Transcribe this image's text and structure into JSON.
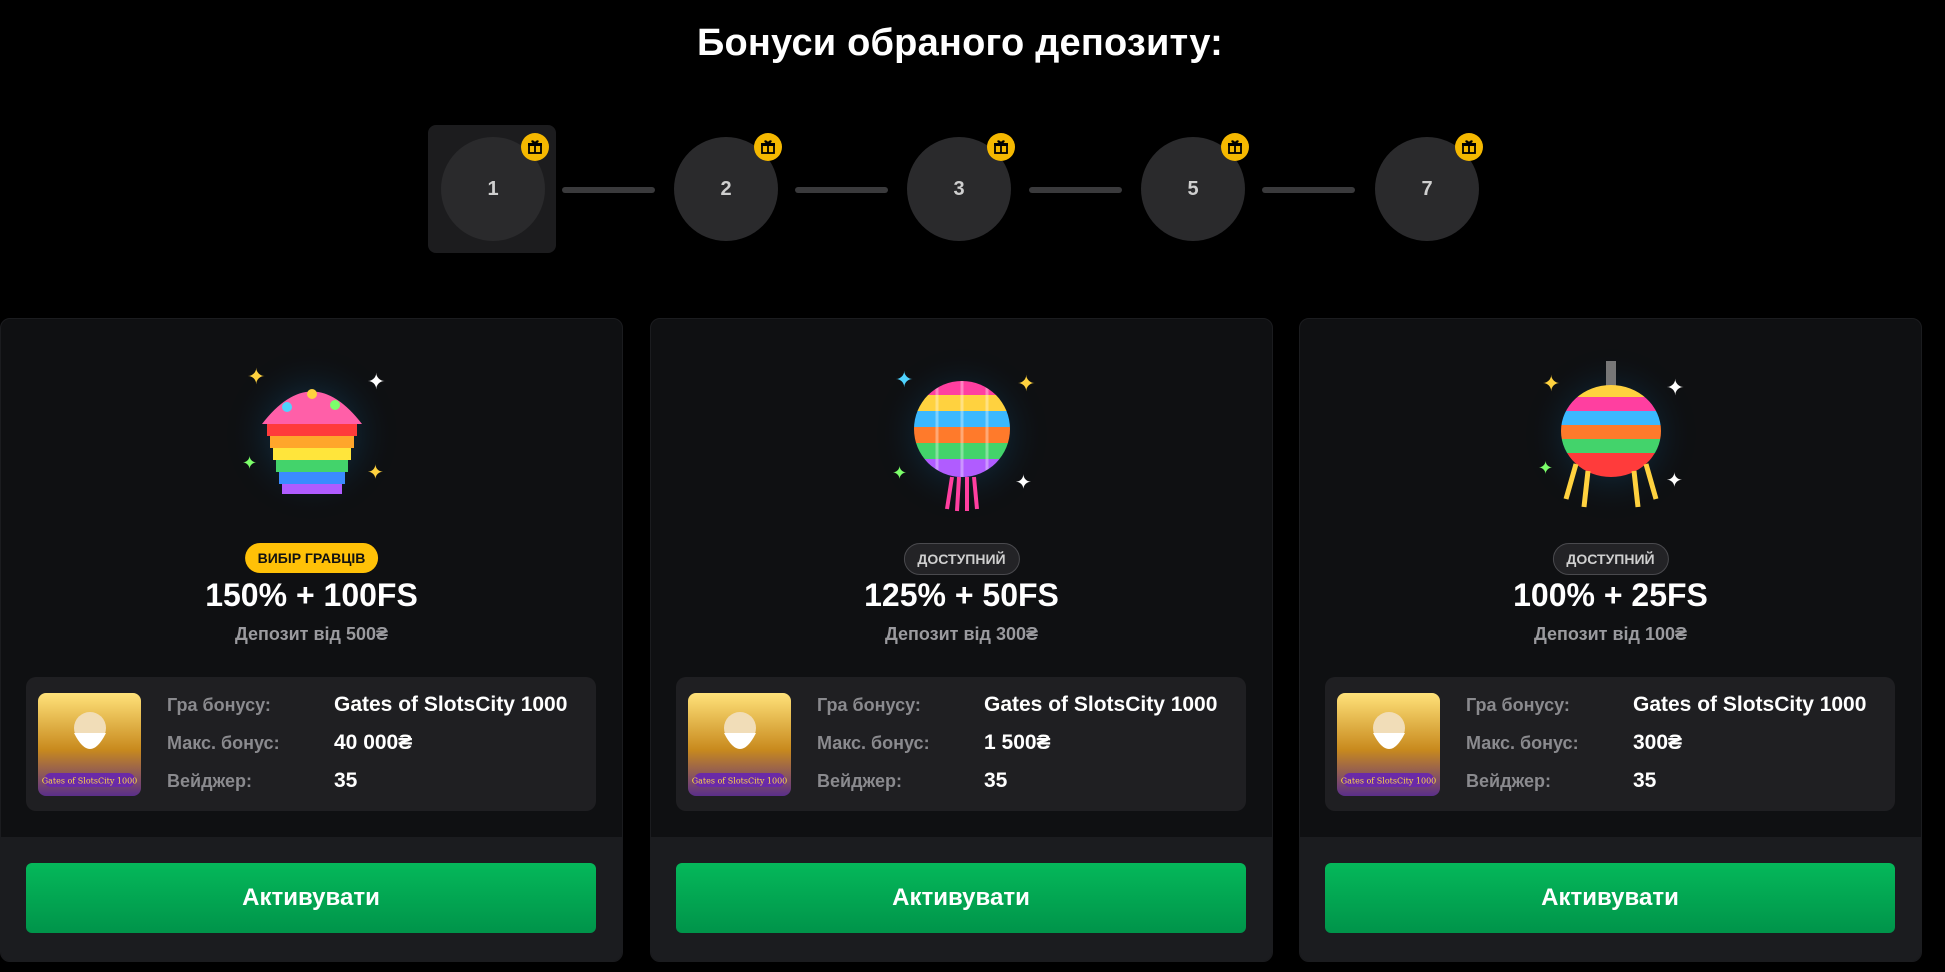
{
  "page_title": "Бонуси обраного депозиту:",
  "stepper": {
    "steps": [
      "1",
      "2",
      "3",
      "5",
      "7"
    ],
    "selected": "1"
  },
  "cards": [
    {
      "badge": "ВИБІР ГРАВЦІВ",
      "offer": "150% + 100FS",
      "deposit": "Депозит від 500₴",
      "game_label": "Гра бонусу:",
      "game_value": "Gates of SlotsCity 1000",
      "max_label": "Макс. бонус:",
      "max_value": "40 000₴",
      "wager_label": "Вейджер:",
      "wager_value": "35",
      "button": "Активувати",
      "art": "cupcake-icon"
    },
    {
      "badge": "ДОСТУПНИЙ",
      "offer": "125% + 50FS",
      "deposit": "Депозит від 300₴",
      "game_label": "Гра бонусу:",
      "game_value": "Gates of SlotsCity 1000",
      "max_label": "Макс. бонус:",
      "max_value": "1 500₴",
      "wager_label": "Вейджер:",
      "wager_value": "35",
      "button": "Активувати",
      "art": "pinata-ball-icon"
    },
    {
      "badge": "ДОСТУПНИЙ",
      "offer": "100% + 25FS",
      "deposit": "Депозит від 100₴",
      "game_label": "Гра бонусу:",
      "game_value": "Gates of SlotsCity 1000",
      "max_label": "Макс. бонус:",
      "max_value": "300₴",
      "wager_label": "Вейджер:",
      "wager_value": "35",
      "button": "Активувати",
      "art": "pinata-drum-icon"
    }
  ],
  "game_thumb_text": "Gates of SlotsCity 1000",
  "colors": {
    "background": "#000000",
    "card": "#0f1012",
    "accent_green": "#05b85a",
    "badge_gold": "#ffc107",
    "gift_icon": "#f5b800"
  }
}
